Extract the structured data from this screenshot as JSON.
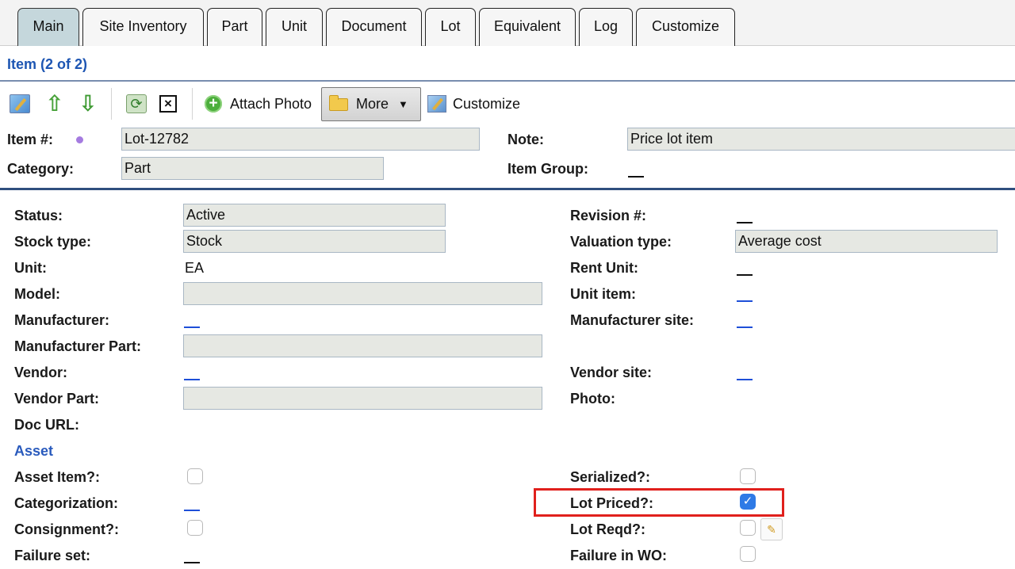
{
  "tabs": [
    {
      "label": "Main",
      "active": true
    },
    {
      "label": "Site Inventory"
    },
    {
      "label": "Part"
    },
    {
      "label": "Unit"
    },
    {
      "label": "Document"
    },
    {
      "label": "Lot"
    },
    {
      "label": "Equivalent"
    },
    {
      "label": "Log"
    },
    {
      "label": "Customize"
    }
  ],
  "header": {
    "title": "Item (2 of 2)"
  },
  "toolbar": {
    "edit_icon": "edit-document-icon",
    "up_icon": "up-arrow-icon",
    "down_icon": "down-arrow-icon",
    "refresh_icon": "refresh-icon",
    "delete_icon": "close-box-icon",
    "attach_photo_label": "Attach Photo",
    "more_label": "More",
    "customize_label": "Customize"
  },
  "top_fields": {
    "item_no_label": "Item #:",
    "item_no_value": "Lot-12782",
    "category_label": "Category:",
    "category_value": "Part",
    "note_label": "Note:",
    "note_value": "Price lot item",
    "item_group_label": "Item Group:"
  },
  "left": {
    "status_label": "Status:",
    "status_value": "Active",
    "stock_type_label": "Stock type:",
    "stock_type_value": "Stock",
    "unit_label": "Unit:",
    "unit_value": "EA",
    "model_label": "Model:",
    "model_value": "",
    "manufacturer_label": "Manufacturer:",
    "manufacturer_part_label": "Manufacturer Part:",
    "manufacturer_part_value": "",
    "vendor_label": "Vendor:",
    "vendor_part_label": "Vendor Part:",
    "vendor_part_value": "",
    "doc_url_label": "Doc URL:",
    "asset_section": "Asset",
    "asset_item_label": "Asset Item?:",
    "categorization_label": "Categorization:",
    "consignment_label": "Consignment?:",
    "failure_set_label": "Failure set:"
  },
  "right": {
    "revision_label": "Revision #:",
    "valuation_type_label": "Valuation type:",
    "valuation_type_value": "Average cost",
    "rent_unit_label": "Rent Unit:",
    "unit_item_label": "Unit item:",
    "manufacturer_site_label": "Manufacturer site:",
    "vendor_site_label": "Vendor site:",
    "photo_label": "Photo:",
    "serialized_label": "Serialized?:",
    "lot_priced_label": "Lot Priced?:",
    "lot_reqd_label": "Lot Reqd?:",
    "failure_in_wo_label": "Failure in WO:"
  },
  "checkboxes": {
    "asset_item": false,
    "consignment": false,
    "serialized": false,
    "lot_priced": true,
    "lot_reqd": false,
    "failure_in_wo": false
  },
  "colors": {
    "accent_blue": "#1e56b3",
    "highlight_red": "#e0201c",
    "active_tab": "#c5d7dc",
    "checkbox_checked": "#2e7ae6"
  }
}
